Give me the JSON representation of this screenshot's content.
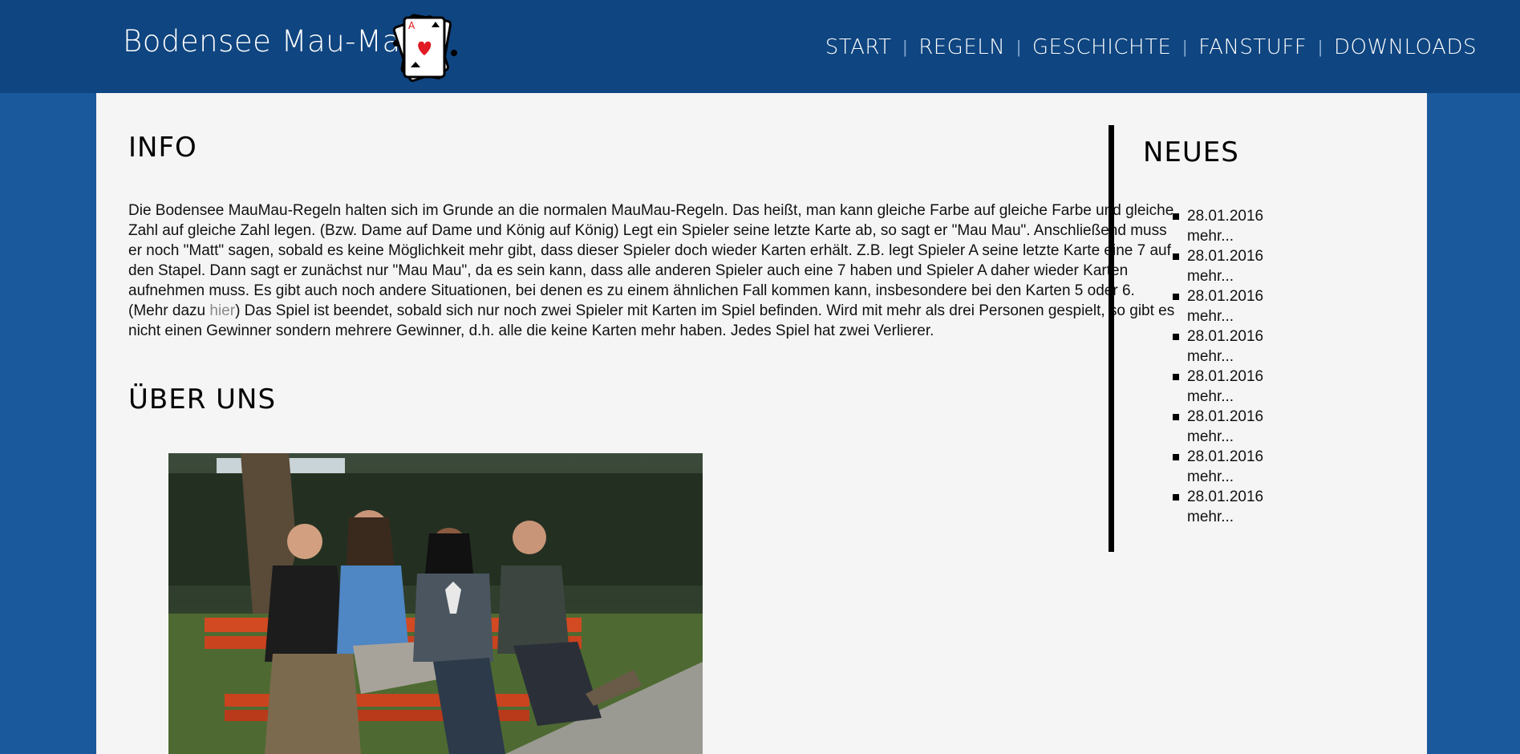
{
  "brand": {
    "logo_text": "Bodensee Mau-Mau"
  },
  "nav": {
    "items": [
      "START",
      "REGELN",
      "GESCHICHTE",
      "FANSTUFF",
      "DOWNLOADS"
    ],
    "separator": "|"
  },
  "info": {
    "heading": "INFO",
    "text_before_link": "Die Bodensee MauMau-Regeln halten sich im Grunde an die normalen MauMau-Regeln. Das heißt, man kann gleiche Farbe auf glei­che Farbe und gleiche Zahl auf gleiche Zahl legen. (Bzw. Dame auf Dame und König auf König) Legt ein Spieler seine letzte Karte ab, so sagt er \"Mau Mau\". Anschließend muss er noch \"Matt\" sagen, sobald es keine Möglichkeit mehr gibt, dass dieser Spieler doch wieder Karten erhält. Z.B. legt Spieler A seine letzte Karte eine 7 auf den Stapel. Dann sagt er zunächst nur \"Mau Mau\", da es sein kann, dass alle anderen Spieler auch eine 7 haben und Spieler A daher wieder Karten aufnehmen muss. Es gibt auch noch andere Situationen, bei denen es zu einem ähnlichen Fall kommen kann, insbesondere bei den Karten 5 oder 6. (Mehr dazu ",
    "link_text": "hier",
    "text_after_link": ") Das Spiel ist beendet, sobald sich nur noch zwei Spieler mit Karten im Spiel befinden. Wird mit mehr als drei Personen gespielt, so gibt es nicht einen Gewinner sondern mehrere Gewinner, d.h. alle die keine Karten mehr haben. Jedes Spiel hat zwei Verlierer."
  },
  "about": {
    "heading": "ÜBER UNS"
  },
  "news": {
    "heading": "NEUES",
    "items": [
      {
        "date": "28.01.2016",
        "more": "mehr..."
      },
      {
        "date": "28.01.2016",
        "more": "mehr..."
      },
      {
        "date": "28.01.2016",
        "more": "mehr..."
      },
      {
        "date": "28.01.2016",
        "more": "mehr..."
      },
      {
        "date": "28.01.2016",
        "more": "mehr..."
      },
      {
        "date": "28.01.2016",
        "more": "mehr..."
      },
      {
        "date": "28.01.2016",
        "more": "mehr..."
      },
      {
        "date": "28.01.2016",
        "more": "mehr..."
      }
    ]
  },
  "colors": {
    "header_bg": "#0f4580",
    "page_bg": "#1a5a9c",
    "content_bg": "#f5f5f5",
    "link": "#8a8a8a"
  },
  "icons": {
    "logo": "playing-card-heart-icon"
  }
}
